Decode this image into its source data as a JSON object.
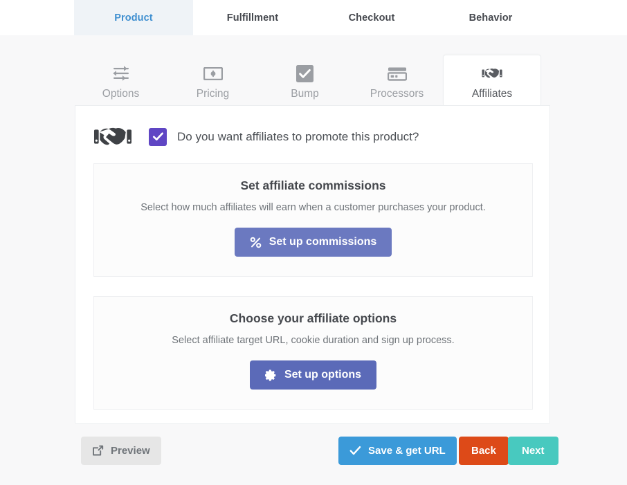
{
  "main_tabs": [
    {
      "label": "Product",
      "active": true
    },
    {
      "label": "Fulfillment",
      "active": false
    },
    {
      "label": "Checkout",
      "active": false
    },
    {
      "label": "Behavior",
      "active": false
    }
  ],
  "sub_tabs": [
    {
      "label": "Options",
      "icon": "sliders-icon",
      "active": false
    },
    {
      "label": "Pricing",
      "icon": "banknote-icon",
      "active": false
    },
    {
      "label": "Bump",
      "icon": "checkbox-icon",
      "active": false
    },
    {
      "label": "Processors",
      "icon": "credit-card-icon",
      "active": false
    },
    {
      "label": "Affiliates",
      "icon": "handshake-icon",
      "active": true
    }
  ],
  "panel": {
    "question": "Do you want affiliates to promote this product?",
    "checkbox_checked": true,
    "header_icon": "handshake-icon",
    "cards": [
      {
        "title": "Set affiliate commissions",
        "description": "Select how much affiliates will earn when a customer purchases your product.",
        "button_label": "Set up commissions",
        "button_icon": "percent-icon"
      },
      {
        "title": "Choose your affiliate options",
        "description": "Select affiliate target URL, cookie duration and sign up process.",
        "button_label": "Set up options",
        "button_icon": "gear-icon"
      }
    ]
  },
  "footer": {
    "preview_label": "Preview",
    "preview_icon": "external-link-icon",
    "save_label": "Save & get URL",
    "save_icon": "check-icon",
    "back_label": "Back",
    "next_label": "Next"
  },
  "colors": {
    "accent_blue": "#3f8fd0",
    "checkbox_purple": "#5f46c4",
    "commissions_button": "#6b79c0",
    "options_button": "#5b6ab8",
    "save_button": "#3b9ad9",
    "back_button": "#dd4a18",
    "next_button": "#48c9bf",
    "page_background": "#f8f8f9"
  }
}
